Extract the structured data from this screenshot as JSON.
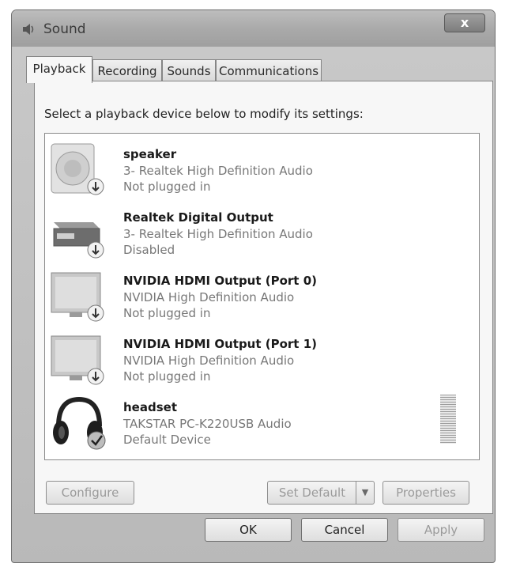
{
  "window": {
    "title": "Sound",
    "close_glyph": "x"
  },
  "tabs": [
    {
      "label": "Playback",
      "active": true
    },
    {
      "label": "Recording",
      "active": false
    },
    {
      "label": "Sounds",
      "active": false
    },
    {
      "label": "Communications",
      "active": false
    }
  ],
  "playback": {
    "instruction": "Select a playback device below to modify its settings:",
    "devices": [
      {
        "name": "speaker",
        "driver": "3- Realtek High Definition Audio",
        "status": "Not plugged in",
        "icon": "speaker-icon"
      },
      {
        "name": "Realtek Digital Output",
        "driver": "3- Realtek High Definition Audio",
        "status": "Disabled",
        "icon": "digital-output-icon"
      },
      {
        "name": "NVIDIA HDMI Output (Port 0)",
        "driver": "NVIDIA High Definition Audio",
        "status": "Not plugged in",
        "icon": "monitor-icon"
      },
      {
        "name": "NVIDIA HDMI Output (Port 1)",
        "driver": "NVIDIA High Definition Audio",
        "status": "Not plugged in",
        "icon": "monitor-icon"
      },
      {
        "name": "headset",
        "driver": "TAKSTAR PC-K220USB Audio",
        "status": "Default Device",
        "icon": "headphones-icon"
      }
    ],
    "buttons": {
      "configure": "Configure",
      "set_default": "Set Default",
      "properties": "Properties"
    }
  },
  "footer": {
    "ok": "OK",
    "cancel": "Cancel",
    "apply": "Apply"
  }
}
